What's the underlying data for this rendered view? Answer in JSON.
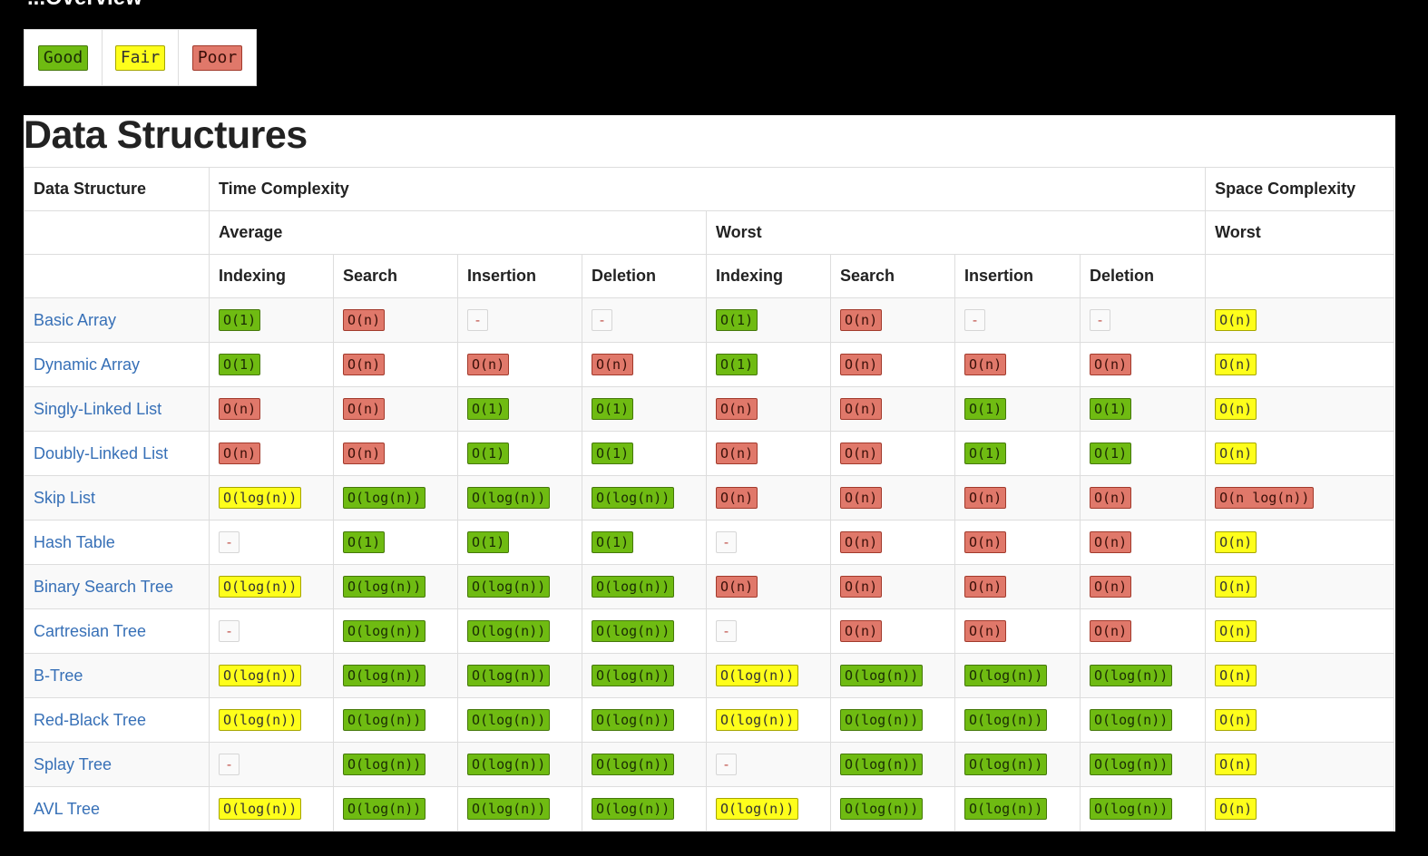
{
  "page": {
    "heading_partial": "...Overview"
  },
  "legend": [
    {
      "label": "Good",
      "rating": "good"
    },
    {
      "label": "Fair",
      "rating": "fair"
    },
    {
      "label": "Poor",
      "rating": "poor"
    }
  ],
  "section": {
    "title": "Data Structures"
  },
  "table": {
    "header": {
      "data_structure": "Data Structure",
      "time_complexity": "Time Complexity",
      "space_complexity": "Space Complexity",
      "average": "Average",
      "worst": "Worst",
      "space_worst": "Worst",
      "operations": [
        "Indexing",
        "Search",
        "Insertion",
        "Deletion",
        "Indexing",
        "Search",
        "Insertion",
        "Deletion"
      ]
    },
    "rows": [
      {
        "name": "Basic Array",
        "cells": [
          {
            "text": "O(1)",
            "rating": "good"
          },
          {
            "text": "O(n)",
            "rating": "poor"
          },
          {
            "text": "-",
            "rating": "gray"
          },
          {
            "text": "-",
            "rating": "gray"
          },
          {
            "text": "O(1)",
            "rating": "good"
          },
          {
            "text": "O(n)",
            "rating": "poor"
          },
          {
            "text": "-",
            "rating": "gray"
          },
          {
            "text": "-",
            "rating": "gray"
          },
          {
            "text": "O(n)",
            "rating": "fair"
          }
        ]
      },
      {
        "name": "Dynamic Array",
        "cells": [
          {
            "text": "O(1)",
            "rating": "good"
          },
          {
            "text": "O(n)",
            "rating": "poor"
          },
          {
            "text": "O(n)",
            "rating": "poor"
          },
          {
            "text": "O(n)",
            "rating": "poor"
          },
          {
            "text": "O(1)",
            "rating": "good"
          },
          {
            "text": "O(n)",
            "rating": "poor"
          },
          {
            "text": "O(n)",
            "rating": "poor"
          },
          {
            "text": "O(n)",
            "rating": "poor"
          },
          {
            "text": "O(n)",
            "rating": "fair"
          }
        ]
      },
      {
        "name": "Singly-Linked List",
        "cells": [
          {
            "text": "O(n)",
            "rating": "poor"
          },
          {
            "text": "O(n)",
            "rating": "poor"
          },
          {
            "text": "O(1)",
            "rating": "good"
          },
          {
            "text": "O(1)",
            "rating": "good"
          },
          {
            "text": "O(n)",
            "rating": "poor"
          },
          {
            "text": "O(n)",
            "rating": "poor"
          },
          {
            "text": "O(1)",
            "rating": "good"
          },
          {
            "text": "O(1)",
            "rating": "good"
          },
          {
            "text": "O(n)",
            "rating": "fair"
          }
        ]
      },
      {
        "name": "Doubly-Linked List",
        "cells": [
          {
            "text": "O(n)",
            "rating": "poor"
          },
          {
            "text": "O(n)",
            "rating": "poor"
          },
          {
            "text": "O(1)",
            "rating": "good"
          },
          {
            "text": "O(1)",
            "rating": "good"
          },
          {
            "text": "O(n)",
            "rating": "poor"
          },
          {
            "text": "O(n)",
            "rating": "poor"
          },
          {
            "text": "O(1)",
            "rating": "good"
          },
          {
            "text": "O(1)",
            "rating": "good"
          },
          {
            "text": "O(n)",
            "rating": "fair"
          }
        ]
      },
      {
        "name": "Skip List",
        "cells": [
          {
            "text": "O(log(n))",
            "rating": "fair"
          },
          {
            "text": "O(log(n))",
            "rating": "good"
          },
          {
            "text": "O(log(n))",
            "rating": "good"
          },
          {
            "text": "O(log(n))",
            "rating": "good"
          },
          {
            "text": "O(n)",
            "rating": "poor"
          },
          {
            "text": "O(n)",
            "rating": "poor"
          },
          {
            "text": "O(n)",
            "rating": "poor"
          },
          {
            "text": "O(n)",
            "rating": "poor"
          },
          {
            "text": "O(n log(n))",
            "rating": "poor"
          }
        ]
      },
      {
        "name": "Hash Table",
        "cells": [
          {
            "text": "-",
            "rating": "gray"
          },
          {
            "text": "O(1)",
            "rating": "good"
          },
          {
            "text": "O(1)",
            "rating": "good"
          },
          {
            "text": "O(1)",
            "rating": "good"
          },
          {
            "text": "-",
            "rating": "gray"
          },
          {
            "text": "O(n)",
            "rating": "poor"
          },
          {
            "text": "O(n)",
            "rating": "poor"
          },
          {
            "text": "O(n)",
            "rating": "poor"
          },
          {
            "text": "O(n)",
            "rating": "fair"
          }
        ]
      },
      {
        "name": "Binary Search Tree",
        "cells": [
          {
            "text": "O(log(n))",
            "rating": "fair"
          },
          {
            "text": "O(log(n))",
            "rating": "good"
          },
          {
            "text": "O(log(n))",
            "rating": "good"
          },
          {
            "text": "O(log(n))",
            "rating": "good"
          },
          {
            "text": "O(n)",
            "rating": "poor"
          },
          {
            "text": "O(n)",
            "rating": "poor"
          },
          {
            "text": "O(n)",
            "rating": "poor"
          },
          {
            "text": "O(n)",
            "rating": "poor"
          },
          {
            "text": "O(n)",
            "rating": "fair"
          }
        ]
      },
      {
        "name": "Cartresian Tree",
        "cells": [
          {
            "text": "-",
            "rating": "gray"
          },
          {
            "text": "O(log(n))",
            "rating": "good"
          },
          {
            "text": "O(log(n))",
            "rating": "good"
          },
          {
            "text": "O(log(n))",
            "rating": "good"
          },
          {
            "text": "-",
            "rating": "gray"
          },
          {
            "text": "O(n)",
            "rating": "poor"
          },
          {
            "text": "O(n)",
            "rating": "poor"
          },
          {
            "text": "O(n)",
            "rating": "poor"
          },
          {
            "text": "O(n)",
            "rating": "fair"
          }
        ]
      },
      {
        "name": "B-Tree",
        "cells": [
          {
            "text": "O(log(n))",
            "rating": "fair"
          },
          {
            "text": "O(log(n))",
            "rating": "good"
          },
          {
            "text": "O(log(n))",
            "rating": "good"
          },
          {
            "text": "O(log(n))",
            "rating": "good"
          },
          {
            "text": "O(log(n))",
            "rating": "fair"
          },
          {
            "text": "O(log(n))",
            "rating": "good"
          },
          {
            "text": "O(log(n))",
            "rating": "good"
          },
          {
            "text": "O(log(n))",
            "rating": "good"
          },
          {
            "text": "O(n)",
            "rating": "fair"
          }
        ]
      },
      {
        "name": "Red-Black Tree",
        "cells": [
          {
            "text": "O(log(n))",
            "rating": "fair"
          },
          {
            "text": "O(log(n))",
            "rating": "good"
          },
          {
            "text": "O(log(n))",
            "rating": "good"
          },
          {
            "text": "O(log(n))",
            "rating": "good"
          },
          {
            "text": "O(log(n))",
            "rating": "fair"
          },
          {
            "text": "O(log(n))",
            "rating": "good"
          },
          {
            "text": "O(log(n))",
            "rating": "good"
          },
          {
            "text": "O(log(n))",
            "rating": "good"
          },
          {
            "text": "O(n)",
            "rating": "fair"
          }
        ]
      },
      {
        "name": "Splay Tree",
        "cells": [
          {
            "text": "-",
            "rating": "gray"
          },
          {
            "text": "O(log(n))",
            "rating": "good"
          },
          {
            "text": "O(log(n))",
            "rating": "good"
          },
          {
            "text": "O(log(n))",
            "rating": "good"
          },
          {
            "text": "-",
            "rating": "gray"
          },
          {
            "text": "O(log(n))",
            "rating": "good"
          },
          {
            "text": "O(log(n))",
            "rating": "good"
          },
          {
            "text": "O(log(n))",
            "rating": "good"
          },
          {
            "text": "O(n)",
            "rating": "fair"
          }
        ]
      },
      {
        "name": "AVL Tree",
        "cells": [
          {
            "text": "O(log(n))",
            "rating": "fair"
          },
          {
            "text": "O(log(n))",
            "rating": "good"
          },
          {
            "text": "O(log(n))",
            "rating": "good"
          },
          {
            "text": "O(log(n))",
            "rating": "good"
          },
          {
            "text": "O(log(n))",
            "rating": "fair"
          },
          {
            "text": "O(log(n))",
            "rating": "good"
          },
          {
            "text": "O(log(n))",
            "rating": "good"
          },
          {
            "text": "O(log(n))",
            "rating": "good"
          },
          {
            "text": "O(n)",
            "rating": "fair"
          }
        ]
      }
    ]
  }
}
